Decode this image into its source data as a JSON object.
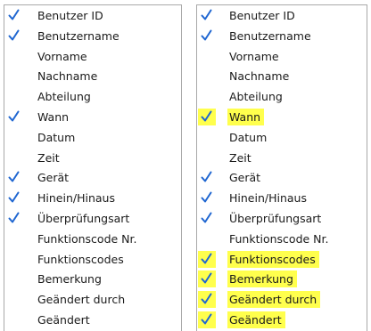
{
  "colors": {
    "check": "#1f66d1",
    "highlight": "#ffff4d",
    "panel_border": "#a9a9a9",
    "text": "#1a1a1a"
  },
  "icons": {
    "checked": "checkmark-icon"
  },
  "panels": [
    {
      "id": "left",
      "items": [
        {
          "label": "Benutzer ID",
          "checked": true
        },
        {
          "label": "Benutzername",
          "checked": true
        },
        {
          "label": "Vorname",
          "checked": false
        },
        {
          "label": "Nachname",
          "checked": false
        },
        {
          "label": "Abteilung",
          "checked": false
        },
        {
          "label": "Wann",
          "checked": true
        },
        {
          "label": "Datum",
          "checked": false
        },
        {
          "label": "Zeit",
          "checked": false
        },
        {
          "label": "Gerät",
          "checked": true
        },
        {
          "label": "Hinein/Hinaus",
          "checked": true
        },
        {
          "label": "Überprüfungsart",
          "checked": true
        },
        {
          "label": "Funktionscode Nr.",
          "checked": false
        },
        {
          "label": "Funktionscodes",
          "checked": false
        },
        {
          "label": "Bemerkung",
          "checked": false
        },
        {
          "label": "Geändert durch",
          "checked": false
        },
        {
          "label": "Geändert",
          "checked": false
        }
      ]
    },
    {
      "id": "right",
      "items": [
        {
          "label": "Benutzer ID",
          "checked": true
        },
        {
          "label": "Benutzername",
          "checked": true
        },
        {
          "label": "Vorname",
          "checked": false
        },
        {
          "label": "Nachname",
          "checked": false
        },
        {
          "label": "Abteilung",
          "checked": false
        },
        {
          "label": "Wann",
          "checked": true,
          "highlighted": true
        },
        {
          "label": "Datum",
          "checked": false
        },
        {
          "label": "Zeit",
          "checked": false
        },
        {
          "label": "Gerät",
          "checked": true
        },
        {
          "label": "Hinein/Hinaus",
          "checked": true
        },
        {
          "label": "Überprüfungsart",
          "checked": true
        },
        {
          "label": "Funktionscode Nr.",
          "checked": false
        },
        {
          "label": "Funktionscodes",
          "checked": true,
          "highlighted": true
        },
        {
          "label": "Bemerkung",
          "checked": true,
          "highlighted": true
        },
        {
          "label": "Geändert durch",
          "checked": true,
          "highlighted": true
        },
        {
          "label": "Geändert",
          "checked": true,
          "highlighted": true
        }
      ]
    }
  ]
}
